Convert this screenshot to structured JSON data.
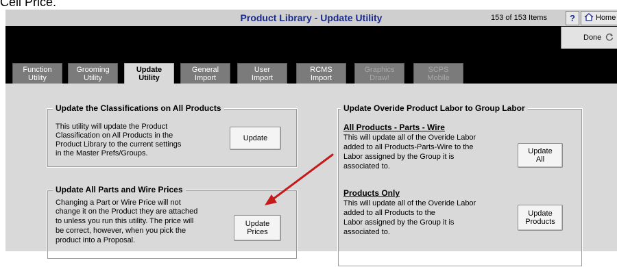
{
  "top_fragment": "Cell Price.",
  "header": {
    "title": "Product Library - Update Utility",
    "item_count": "153 of 153 Items",
    "help_label": "?",
    "home_label": "Home",
    "done_label": "Done"
  },
  "tabs": [
    {
      "line1": "Function",
      "line2": "Utility"
    },
    {
      "line1": "Grooming",
      "line2": "Utility"
    },
    {
      "line1": "Update",
      "line2": "Utility"
    },
    {
      "line1": "General",
      "line2": "Import"
    },
    {
      "line1": "User",
      "line2": "Import"
    },
    {
      "line1": "RCMS",
      "line2": "Import"
    },
    {
      "line1": "Graphics",
      "line2": "Draw!"
    },
    {
      "line1": "SCPS",
      "line2": "Mobile"
    }
  ],
  "classifications": {
    "legend": "Update the Classifications on All Products",
    "lines": [
      "This utility will update the Product",
      "Classification on All Products in the",
      "Product Library to the current settings",
      "in the Master Prefs/Groups."
    ],
    "button": "Update"
  },
  "prices": {
    "legend": "Update All Parts and Wire Prices",
    "lines": [
      "Changing a Part or Wire Price will not",
      "change it on the Product they are attached",
      "to unless you run this utility. The price will",
      "be correct, however, when you pick the",
      "product into a Proposal."
    ],
    "button_line1": "Update",
    "button_line2": "Prices"
  },
  "labor": {
    "legend": "Update Overide Product Labor to Group Labor",
    "all": {
      "heading": "All Products - Parts - Wire",
      "lines": [
        "This will update all of the Overide Labor",
        "added to all Products-Parts-Wire to the",
        "Labor assigned by the Group it is",
        "associated to."
      ],
      "button_line1": "Update",
      "button_line2": "All"
    },
    "products": {
      "heading": "Products Only",
      "lines": [
        "This will update all of the Overide Labor",
        "added to all Products to the",
        "Labor assigned by the Group it is",
        "associated to."
      ],
      "button_line1": "Update",
      "button_line2": "Products"
    }
  },
  "colors": {
    "title_text": "#1a2a8a",
    "panel_bg": "#d9d9d9",
    "tab_bg": "#7b7b7b",
    "arrow": "#c41a1a"
  }
}
